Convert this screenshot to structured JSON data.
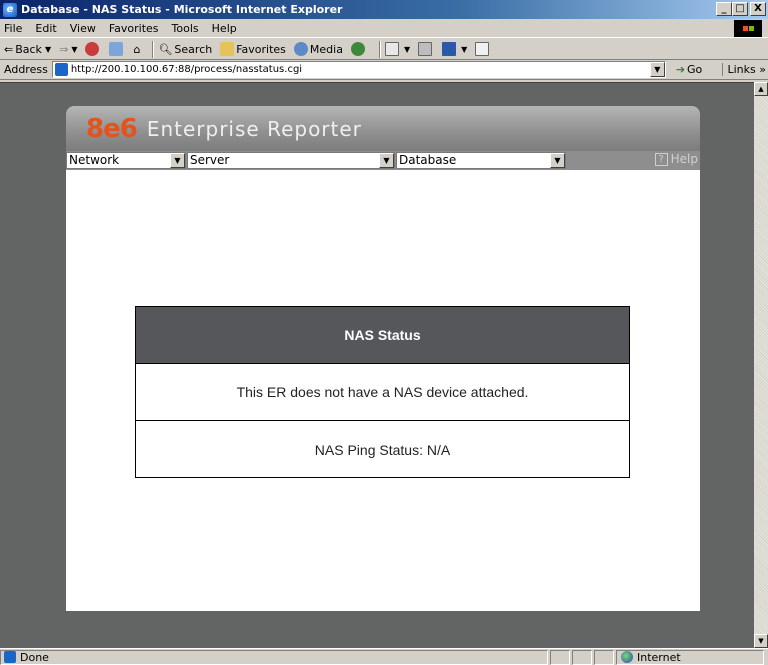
{
  "window": {
    "title": "Database - NAS Status - Microsoft Internet Explorer",
    "min_label": "_",
    "max_label": "□",
    "close_label": "X"
  },
  "menu": [
    "File",
    "Edit",
    "View",
    "Favorites",
    "Tools",
    "Help"
  ],
  "toolbar": {
    "back": "Back",
    "search": "Search",
    "favorites": "Favorites",
    "media": "Media"
  },
  "address": {
    "label": "Address",
    "url": "http://200.10.100.67:88/process/nasstatus.cgi",
    "go": "Go",
    "links": "Links"
  },
  "app": {
    "brand_logo": "8e6",
    "brand_name": "Enterprise Reporter",
    "nav": {
      "network": "Network",
      "server": "Server",
      "database": "Database",
      "help": "Help"
    }
  },
  "nas": {
    "heading": "NAS Status",
    "message": "This ER does not have a NAS device attached.",
    "ping_status": "NAS Ping Status: N/A"
  },
  "status": {
    "text": "Done",
    "zone": "Internet"
  },
  "colors": {
    "brand_orange": "#e2541c",
    "table_header": "#55575a",
    "page_background": "#636464"
  }
}
